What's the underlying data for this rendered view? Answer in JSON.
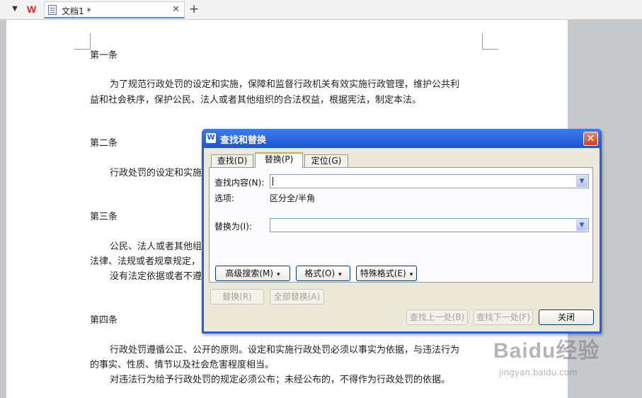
{
  "tabbar": {
    "doc_tab_label": "文档1 *",
    "close_glyph": "✕",
    "add_glyph": "+",
    "menu_glyph": "▼",
    "logo_glyph": "W"
  },
  "document": {
    "lines": [
      "第一条",
      "为了规范行政处罚的设定和实施，保障和监督行政机关有效实施行政管理，维护公共利",
      "益和社会秩序，保护公民、法人或者其他组织的合法权益，根据宪法，制定本法。",
      "第二条",
      "行政处罚的设定和实施",
      "第三条",
      "公民、法人或者其他组",
      "法律、法规或者规章规定，",
      "没有法定依据或者不遵",
      "第四条",
      "行政处罚遵循公正、公开的原则。设定和实施行政处罚必须以事实为依据，与违法行为",
      "的事实、性质、情节以及社会危害程度相当。",
      "对违法行为给予行政处罚的规定必须公布；未经公布的，不得作为行政处罚的依据。"
    ]
  },
  "dialog": {
    "title": "查找和替换",
    "title_icon": "W",
    "close_glyph": "✕",
    "tabs": [
      {
        "label": "查找(D)"
      },
      {
        "label": "替换(P)"
      },
      {
        "label": "定位(G)"
      }
    ],
    "active_tab": "替换(P)",
    "find_label": "查找内容(N):",
    "find_value": "",
    "options_label": "选项:",
    "options_value": "区分全/半角",
    "replace_label": "替换为(I):",
    "replace_value": "",
    "advanced_button": "高级搜索(M)",
    "advanced_arrow": "▾",
    "format_button": "格式(O)",
    "format_arrow": "▾",
    "special_button": "特殊格式(E)",
    "special_arrow": "▾",
    "replace_button": "替换(R)",
    "replace_all_button": "全部替换(A)",
    "find_prev_button": "查找上一处(B)",
    "find_next_button": "查找下一处(F)",
    "close_button": "关闭",
    "dropdown_glyph": "▼"
  },
  "watermark": {
    "main": "Baidu经验",
    "sub": "jingyan.baidu.com"
  },
  "colors": {
    "title_bar": "#2a5fd1",
    "dialog_face": "#ece9d8",
    "active_tab_accent": "#f0a33a",
    "close_button": "#c4412a"
  }
}
